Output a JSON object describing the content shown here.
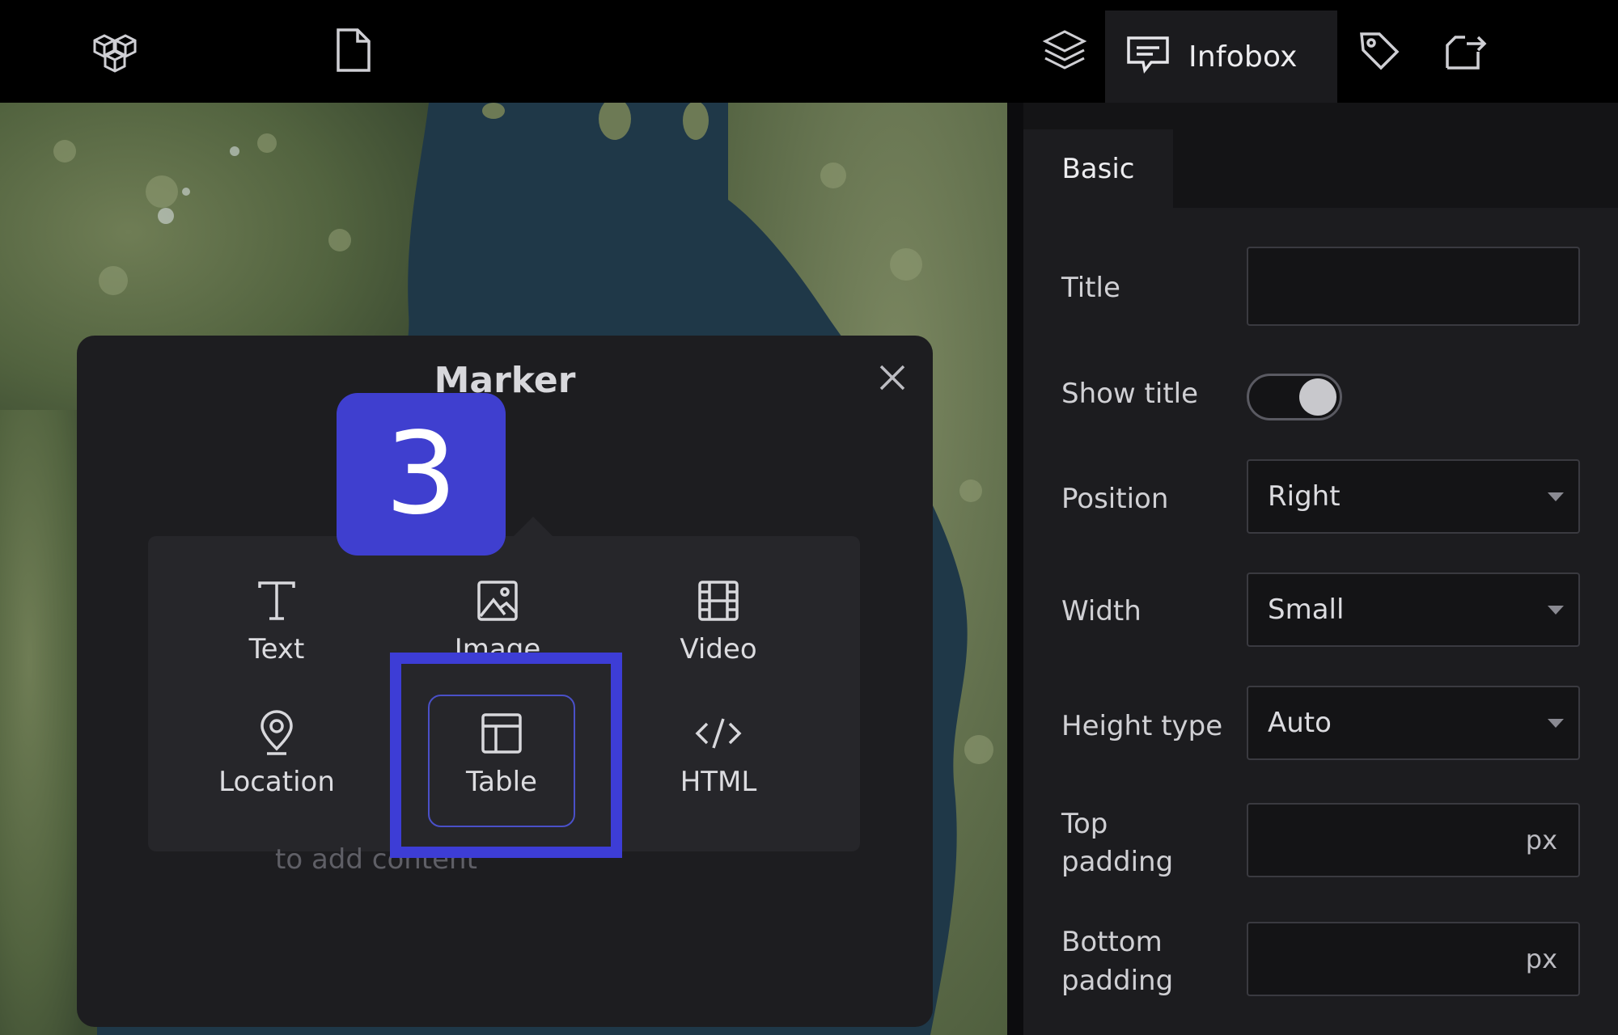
{
  "topbar": {
    "icons": [
      "cubes-icon",
      "document-icon",
      "layers-icon",
      "infobox-icon",
      "tag-icon",
      "export-icon"
    ],
    "active_tab_label": "Infobox"
  },
  "panel": {
    "tab_label": "Basic",
    "fields": {
      "title_label": "Title",
      "title_value": "",
      "show_title_label": "Show title",
      "show_title_on": true,
      "position_label": "Position",
      "position_value": "Right",
      "width_label": "Width",
      "width_value": "Small",
      "height_type_label": "Height type",
      "height_type_value": "Auto",
      "top_padding_label_1": "Top",
      "top_padding_label_2": "padding",
      "top_padding_unit": "px",
      "bottom_padding_label_1": "Bottom",
      "bottom_padding_label_2": "padding",
      "bottom_padding_unit": "px"
    }
  },
  "modal": {
    "title": "Marker",
    "placeholder": "to add content",
    "menu": [
      {
        "label": "Text",
        "icon": "text-icon"
      },
      {
        "label": "Image",
        "icon": "image-icon"
      },
      {
        "label": "Video",
        "icon": "video-icon"
      },
      {
        "label": "Location",
        "icon": "location-icon"
      },
      {
        "label": "Table",
        "icon": "table-icon"
      },
      {
        "label": "HTML",
        "icon": "code-icon"
      }
    ]
  },
  "annotation": {
    "step_number": "3",
    "accent_color": "#3d3dd6"
  }
}
